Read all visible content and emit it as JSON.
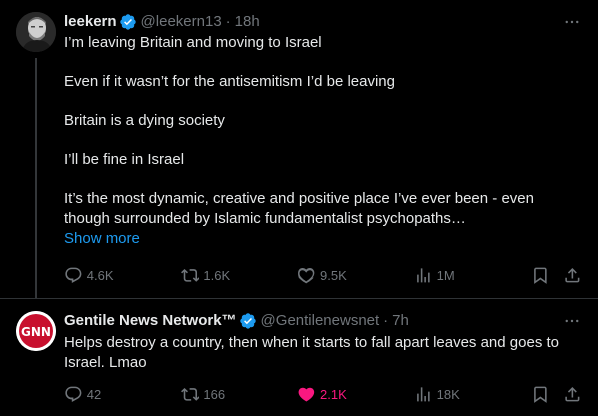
{
  "tweets": [
    {
      "name": "leekern",
      "handle": "@leekern13",
      "time": "18h",
      "paragraphs": [
        "I’m leaving Britain and moving to Israel",
        "Even if it wasn’t for the antisemitism I’d be leaving",
        "Britain is a dying society",
        "I’ll be fine in Israel",
        "It’s the most dynamic, creative and positive place I’ve ever been - even though surrounded by Islamic fundamentalist psychopaths…"
      ],
      "show_more": "Show more",
      "replies": "4.6K",
      "reposts": "1.6K",
      "likes": "9.5K",
      "views": "1M"
    },
    {
      "name": "Gentile News Network™",
      "handle": "@Gentilenewsnet",
      "time": "7h",
      "text": "Helps destroy a country, then when it starts to fall apart leaves and goes to Israel. Lmao",
      "avatar_text": "GNN",
      "replies": "42",
      "reposts": "166",
      "likes": "2.1K",
      "views": "18K"
    }
  ],
  "icons": {
    "verified": "verified-badge-icon",
    "more": "more-dots-icon",
    "reply": "reply-bubble-icon",
    "repost": "repost-icon",
    "like": "heart-icon",
    "views": "views-chart-icon",
    "bookmark": "bookmark-icon",
    "share": "share-icon"
  },
  "colors": {
    "background": "#000000",
    "text": "#e7e9ea",
    "muted": "#71767b",
    "link": "#1d9bf0",
    "like_active": "#f91880",
    "verified": "#1d9bf0"
  }
}
